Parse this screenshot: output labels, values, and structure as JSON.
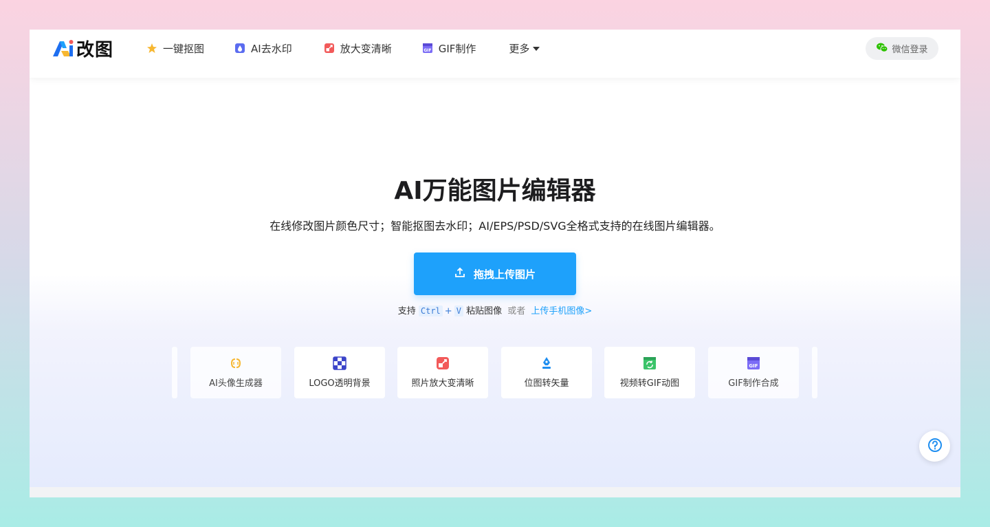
{
  "header": {
    "logo_text": "改图",
    "nav": [
      {
        "label": "一键抠图",
        "icon": "magic-star-icon"
      },
      {
        "label": "AI去水印",
        "icon": "watermark-icon"
      },
      {
        "label": "放大变清晰",
        "icon": "enlarge-icon"
      },
      {
        "label": "GIF制作",
        "icon": "gif-icon"
      },
      {
        "label": "更多",
        "icon": "caret-down-icon"
      }
    ],
    "login_label": "微信登录"
  },
  "hero": {
    "title": "AI万能图片编辑器",
    "subtitle": "在线修改图片颜色尺寸；智能抠图去水印；AI/EPS/PSD/SVG全格式支持的在线图片编辑器。",
    "upload_label": "拖拽上传图片",
    "paste_prefix": "支持",
    "key_ctrl": "Ctrl",
    "key_plus": "+",
    "key_v": "V",
    "paste_suffix": "粘贴图像",
    "or_text": "或者",
    "mobile_link": "上传手机图像>"
  },
  "tools": [
    {
      "label": "AI头像生成器",
      "icon": "ai-avatar-icon"
    },
    {
      "label": "LOGO透明背景",
      "icon": "transparent-grid-icon"
    },
    {
      "label": "照片放大变清晰",
      "icon": "enlarge-icon"
    },
    {
      "label": "位图转矢量",
      "icon": "pen-nib-icon"
    },
    {
      "label": "视频转GIF动图",
      "icon": "video-convert-icon"
    },
    {
      "label": "GIF制作合成",
      "icon": "gif-icon"
    }
  ],
  "colors": {
    "primary": "#1ea1fb",
    "star": "#f7b731",
    "enlarge": "#f25a5a",
    "gif": "#7b6cf6",
    "video": "#3cc46a"
  }
}
